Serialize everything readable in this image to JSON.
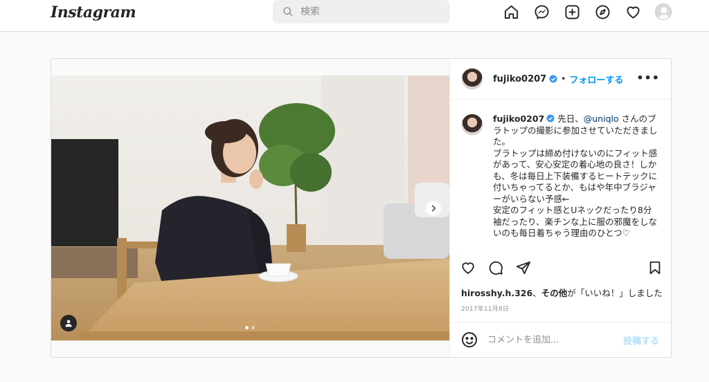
{
  "header": {
    "logo": "Instagram",
    "search_placeholder": "検索"
  },
  "post": {
    "username": "fujiko0207",
    "separator": "•",
    "follow_label": "フォローする",
    "more_label": "•••",
    "caption": {
      "username": "fujiko0207",
      "text_before_mention": " 先日、",
      "mention": "@uniqlo",
      "text_after_mention": " さんのブラトップの撮影に参加させていただきました。\nブラトップは締め付けないのにフィット感があって、安心安定の着心地の良さ！しかも、冬は毎日上下装備するヒートテックに付いちゃってるとか、もはや年中ブラジャーがいらない予感←\n安定のフィット感とUネックだったり8分袖だったり、楽チンな上に服の邪魔をしないのも毎日着ちゃう理由のひとつ♡"
    },
    "likes": {
      "user": "hirosshy.h.326",
      "sep": "、",
      "others": "その他",
      "suffix": "が「いいね！」しました"
    },
    "date": "2017年11月8日",
    "comment_placeholder": "コメントを追加...",
    "post_button": "投稿する"
  },
  "colors": {
    "accent": "#0095f6",
    "post_button_disabled": "#b2dffc"
  }
}
